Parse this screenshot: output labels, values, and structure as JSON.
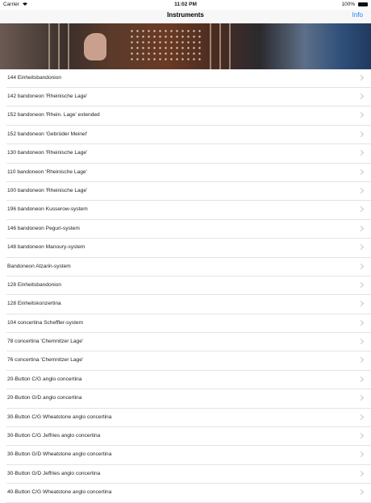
{
  "status_bar": {
    "carrier": "Carrier",
    "time": "11:02 PM",
    "battery": "100%"
  },
  "nav": {
    "title": "Instruments",
    "info_label": "Info"
  },
  "instruments": [
    "144 Einheitsbandonion",
    "142 bandoneon 'Rheinische Lage'",
    "152 bandoneon 'Rhein. Lage' extended",
    "152 bandoneon 'Gebrüder Meinel'",
    "130 bandoneon 'Rheinische Lage'",
    "110 bandoneon 'Rheinische Lage'",
    "100 bandoneon 'Rheinische Lage'",
    "196 bandoneon Kusserow-system",
    "146 bandoneon Peguri-system",
    "148 bandoneon Manoury-system",
    "Bandoneon Atzarin-system",
    "128 Einheitsbandonion",
    "128 Einheitskonzertina",
    "104 concertina Scheffler-system",
    "78 concertina 'Chemnitzer Lage'",
    "76 concertina 'Chemnitzer Lage'",
    "20-Button C/G anglo concertina",
    "20-Button G/D anglo concertina",
    "30-Button C/G Wheatstone anglo concertina",
    "30-Button C/G Jeffries anglo concertina",
    "30-Button G/D Wheatstone anglo concertina",
    "30-Button G/D Jeffries anglo concertina",
    "40-Button C/G Wheatstone anglo concertina"
  ]
}
